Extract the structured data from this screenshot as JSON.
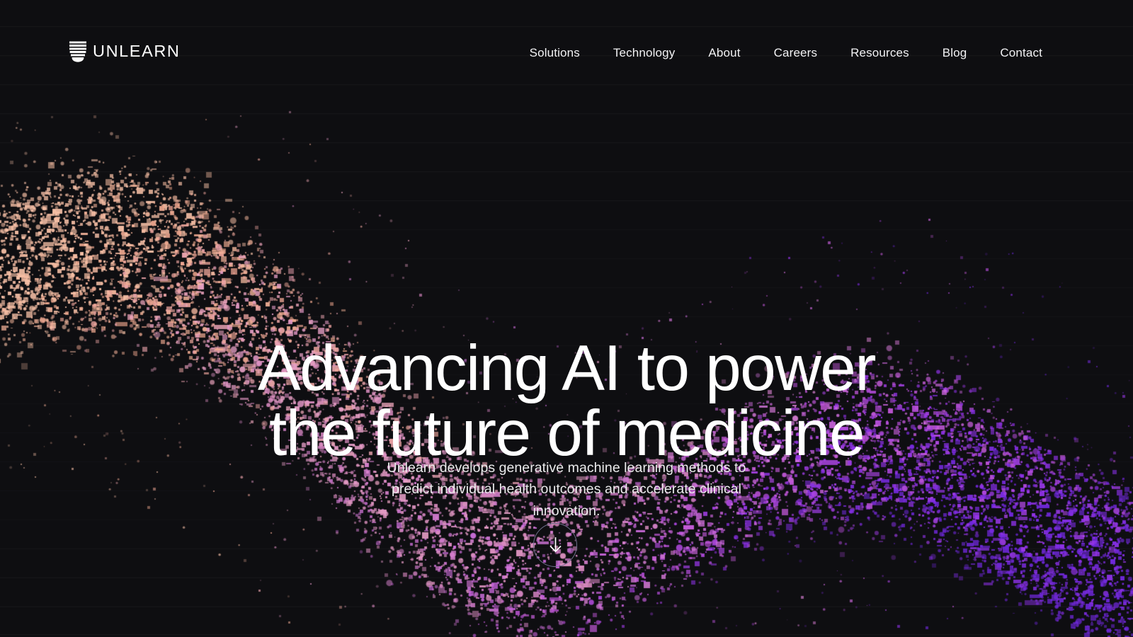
{
  "site": {
    "background_color": "#0e0e11",
    "brand_name": "UNLEARN",
    "logo_icon": "unlearn-shield-mark"
  },
  "header": {
    "logo_label": "UNLEARN",
    "nav": [
      {
        "label": "Solutions"
      },
      {
        "label": "Technology"
      },
      {
        "label": "About"
      },
      {
        "label": "Careers"
      },
      {
        "label": "Resources"
      },
      {
        "label": "Blog"
      },
      {
        "label": "Contact"
      }
    ]
  },
  "hero": {
    "headline": "Advancing AI to power\nthe future of medicine",
    "subheadline": "Unlearn develops generative machine learning methods to predict individual health outcomes and accelerate clinical innovation.",
    "scroll_button_icon": "arrow-down-icon",
    "scroll_button_label": "Scroll down"
  },
  "visual": {
    "type": "particle-wave-field",
    "palette": {
      "peach": "#f7c0a6",
      "salmon": "#f1a88e",
      "pink": "#e7a0c6",
      "rose": "#d98ac0",
      "orchid": "#cf70dd",
      "magenta": "#bf55d6",
      "violet": "#9333ea",
      "deep_violet": "#7028dd"
    },
    "gridline_color": "#1a1a1f",
    "gridline_spacing_px": 41
  }
}
